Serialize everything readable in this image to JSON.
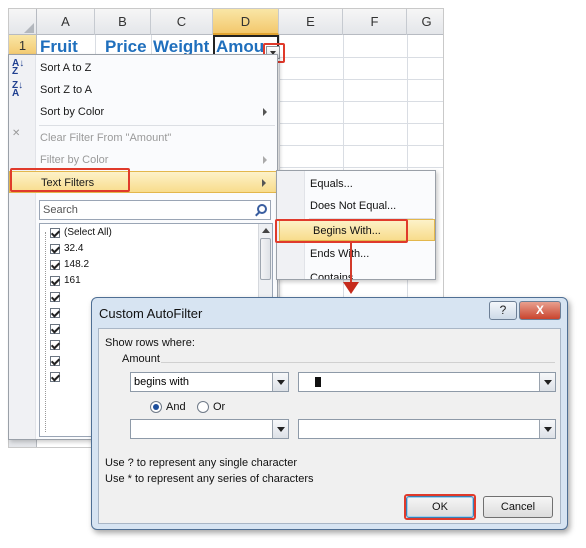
{
  "sheet": {
    "columns": [
      "A",
      "B",
      "C",
      "D",
      "E",
      "F",
      "G"
    ],
    "row_number": "1",
    "headers": [
      "Fruit",
      "Price",
      "Weight",
      "Amou"
    ]
  },
  "filter_menu": {
    "sort_az": "Sort A to Z",
    "sort_za": "Sort Z to A",
    "sort_color": "Sort by Color",
    "clear_filter": "Clear Filter From \"Amount\"",
    "filter_color": "Filter by Color",
    "text_filters": "Text Filters",
    "search_placeholder": "Search",
    "list_items": [
      "(Select All)",
      "32.4",
      "148.2",
      "161",
      "",
      "",
      "",
      "",
      "",
      ""
    ]
  },
  "submenu": {
    "items": [
      "Equals...",
      "Does Not Equal...",
      "Begins With...",
      "Ends With...",
      "Contains..."
    ]
  },
  "dialog": {
    "title": "Custom AutoFilter",
    "help_btn": "?",
    "close_btn": "X",
    "show_rows": "Show rows where:",
    "field": "Amount",
    "operator1": "begins with",
    "value1": "",
    "and_label": "And",
    "or_label": "Or",
    "operator2": "",
    "value2": "",
    "hint1": "Use ? to represent any single character",
    "hint2": "Use * to represent any series of characters",
    "ok": "OK",
    "cancel": "Cancel"
  },
  "colors": {
    "header_text": "#1f6fbd",
    "highlight": "#e03a2b"
  }
}
